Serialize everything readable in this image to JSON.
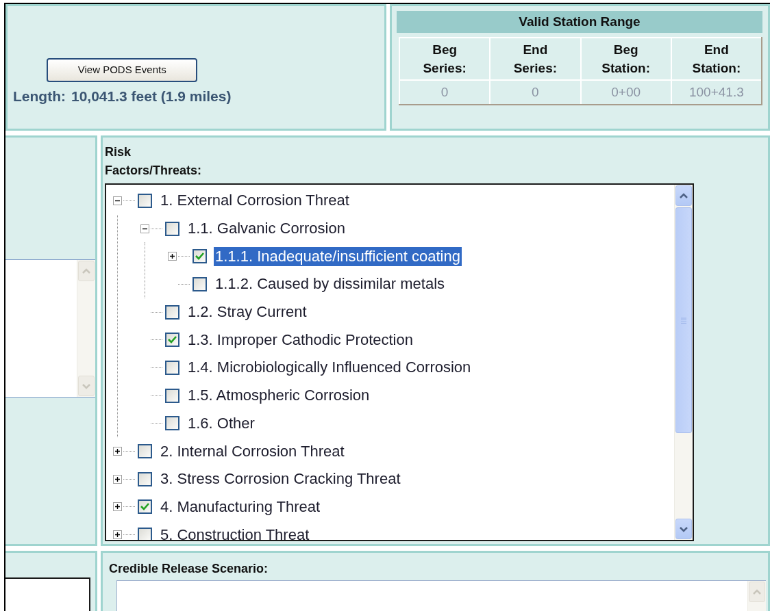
{
  "view_events_button": "View PODS Events",
  "length_summary": {
    "label": "Length:",
    "value": "10,041.3 feet (1.9 miles)"
  },
  "station_range": {
    "title": "Valid Station Range",
    "columns": [
      "Beg Series:",
      "End Series:",
      "Beg Station:",
      "End Station:"
    ],
    "values": [
      "0",
      "0",
      "0+00",
      "100+41.3"
    ]
  },
  "risk_factors": {
    "label": "Risk Factors/Threats:",
    "tree": [
      {
        "label": "1. External Corrosion Threat",
        "checked": false,
        "selected": false,
        "expanded": true,
        "children": [
          {
            "label": "1.1. Galvanic Corrosion",
            "checked": false,
            "selected": false,
            "expanded": true,
            "children": [
              {
                "label": "1.1.1. Inadequate/insufficient coating",
                "checked": true,
                "selected": true,
                "expanded": false
              },
              {
                "label": "1.1.2. Caused by dissimilar metals",
                "checked": false,
                "selected": false
              }
            ]
          },
          {
            "label": "1.2. Stray Current",
            "checked": false,
            "selected": false
          },
          {
            "label": "1.3. Improper Cathodic Protection",
            "checked": true,
            "selected": false
          },
          {
            "label": "1.4. Microbiologically Influenced Corrosion",
            "checked": false,
            "selected": false
          },
          {
            "label": "1.5. Atmospheric Corrosion",
            "checked": false,
            "selected": false
          },
          {
            "label": "1.6. Other",
            "checked": false,
            "selected": false
          }
        ]
      },
      {
        "label": "2. Internal Corrosion Threat",
        "checked": false,
        "selected": false,
        "expanded": false
      },
      {
        "label": "3. Stress Corrosion Cracking Threat",
        "checked": false,
        "selected": false,
        "expanded": false
      },
      {
        "label": "4. Manufacturing Threat",
        "checked": true,
        "selected": false,
        "expanded": false
      },
      {
        "label": "5. Construction Threat",
        "checked": false,
        "selected": false,
        "expanded": false
      }
    ]
  },
  "credible_release": {
    "label": "Credible Release Scenario:"
  }
}
